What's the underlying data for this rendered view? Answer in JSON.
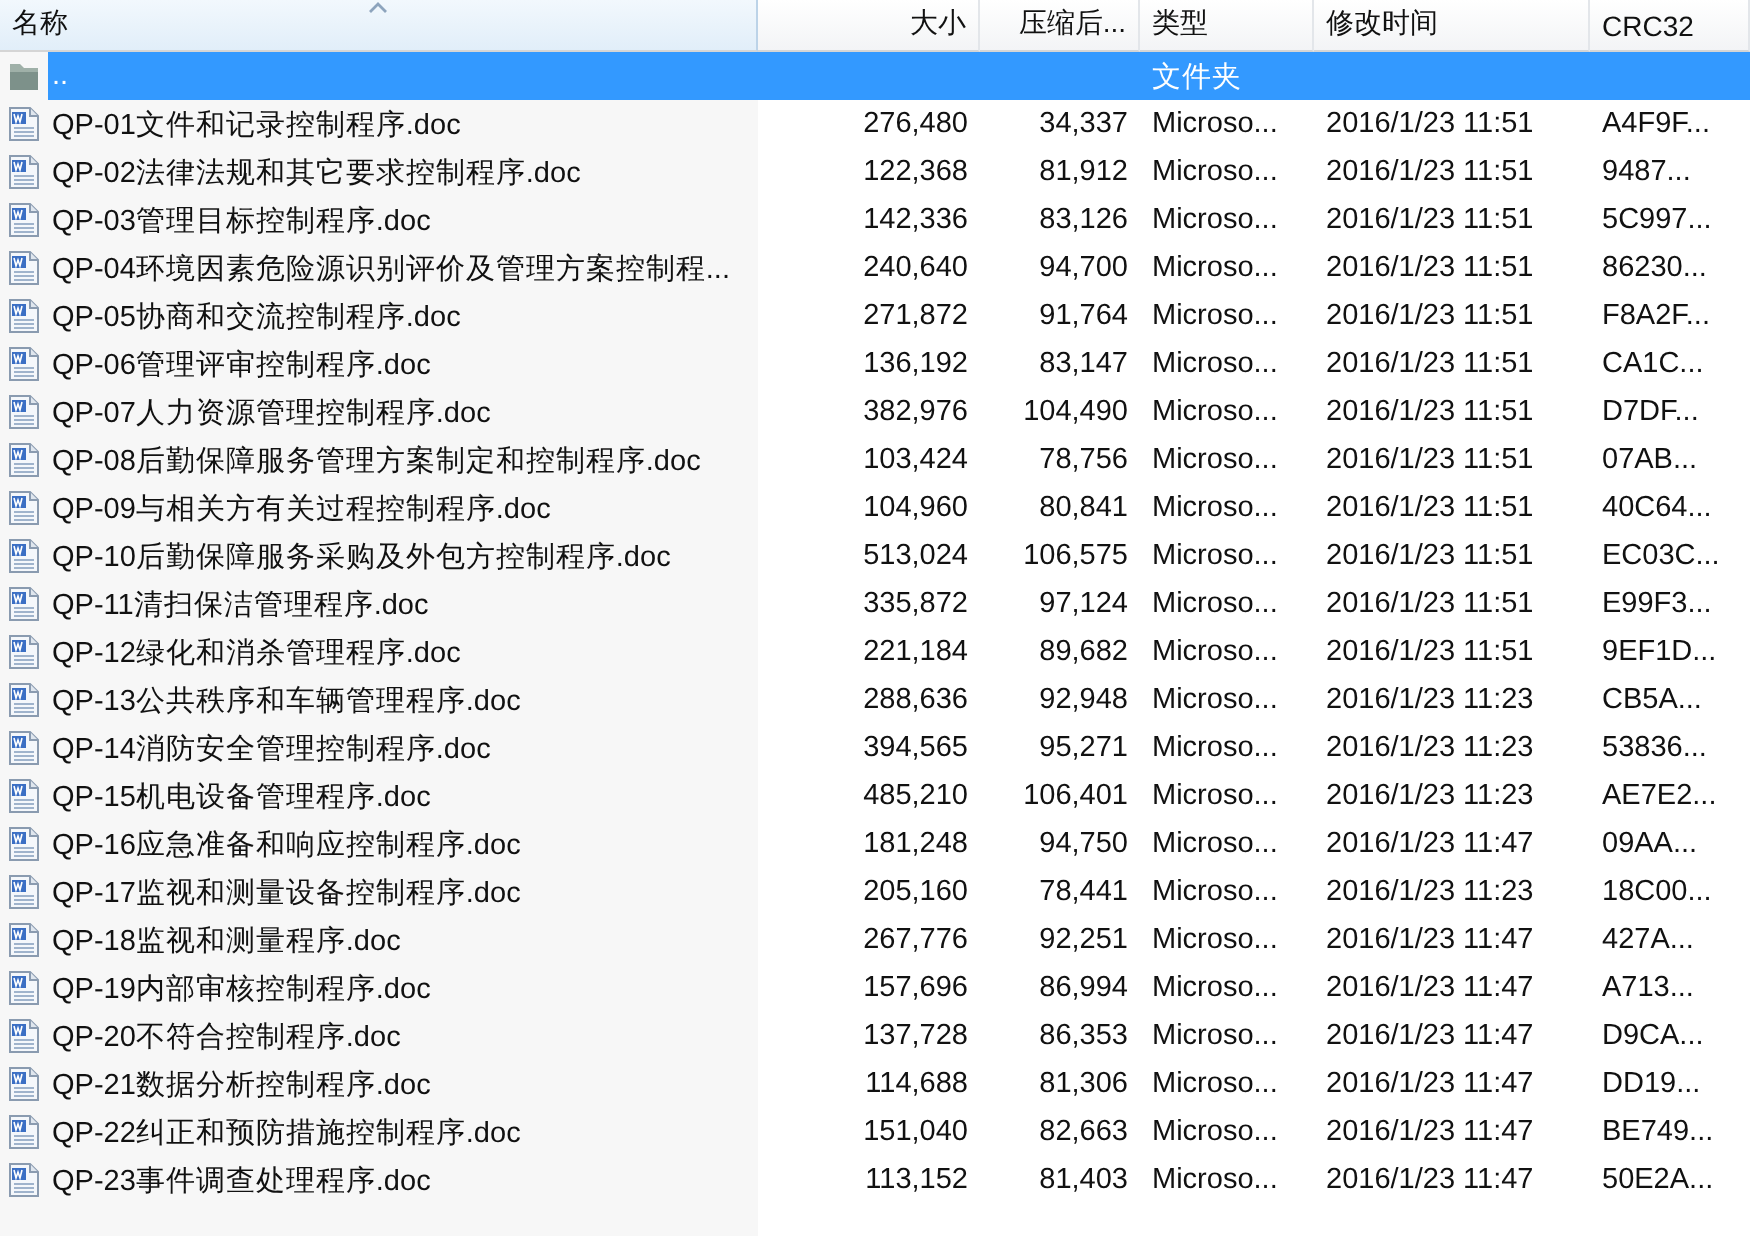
{
  "columns": [
    {
      "label": "名称",
      "sorted": true
    },
    {
      "label": "大小",
      "sorted": false
    },
    {
      "label": "压缩后...",
      "sorted": false
    },
    {
      "label": "类型",
      "sorted": false
    },
    {
      "label": "修改时间",
      "sorted": false
    },
    {
      "label": "CRC32",
      "sorted": false
    }
  ],
  "rows": [
    {
      "kind": "folder",
      "selected": true,
      "name": "..",
      "type": "文件夹"
    },
    {
      "kind": "doc",
      "selected": false,
      "name": "QP-01文件和记录控制程序.doc",
      "size": "276,480",
      "packed": "34,337",
      "type": "Microso...",
      "modified": "2016/1/23 11:51",
      "crc": "A4F9F..."
    },
    {
      "kind": "doc",
      "selected": false,
      "name": "QP-02法律法规和其它要求控制程序.doc",
      "size": "122,368",
      "packed": "81,912",
      "type": "Microso...",
      "modified": "2016/1/23 11:51",
      "crc": "9487..."
    },
    {
      "kind": "doc",
      "selected": false,
      "name": "QP-03管理目标控制程序.doc",
      "size": "142,336",
      "packed": "83,126",
      "type": "Microso...",
      "modified": "2016/1/23 11:51",
      "crc": "5C997..."
    },
    {
      "kind": "doc",
      "selected": false,
      "name": "QP-04环境因素危险源识别评价及管理方案控制程...",
      "size": "240,640",
      "packed": "94,700",
      "type": "Microso...",
      "modified": "2016/1/23 11:51",
      "crc": "86230..."
    },
    {
      "kind": "doc",
      "selected": false,
      "name": "QP-05协商和交流控制程序.doc",
      "size": "271,872",
      "packed": "91,764",
      "type": "Microso...",
      "modified": "2016/1/23 11:51",
      "crc": "F8A2F..."
    },
    {
      "kind": "doc",
      "selected": false,
      "name": "QP-06管理评审控制程序.doc",
      "size": "136,192",
      "packed": "83,147",
      "type": "Microso...",
      "modified": "2016/1/23 11:51",
      "crc": "CA1C..."
    },
    {
      "kind": "doc",
      "selected": false,
      "name": "QP-07人力资源管理控制程序.doc",
      "size": "382,976",
      "packed": "104,490",
      "type": "Microso...",
      "modified": "2016/1/23 11:51",
      "crc": "D7DF..."
    },
    {
      "kind": "doc",
      "selected": false,
      "name": "QP-08后勤保障服务管理方案制定和控制程序.doc",
      "size": "103,424",
      "packed": "78,756",
      "type": "Microso...",
      "modified": "2016/1/23 11:51",
      "crc": "07AB..."
    },
    {
      "kind": "doc",
      "selected": false,
      "name": "QP-09与相关方有关过程控制程序.doc",
      "size": "104,960",
      "packed": "80,841",
      "type": "Microso...",
      "modified": "2016/1/23 11:51",
      "crc": "40C64..."
    },
    {
      "kind": "doc",
      "selected": false,
      "name": "QP-10后勤保障服务采购及外包方控制程序.doc",
      "size": "513,024",
      "packed": "106,575",
      "type": "Microso...",
      "modified": "2016/1/23 11:51",
      "crc": "EC03C..."
    },
    {
      "kind": "doc",
      "selected": false,
      "name": "QP-11清扫保洁管理程序.doc",
      "size": "335,872",
      "packed": "97,124",
      "type": "Microso...",
      "modified": "2016/1/23 11:51",
      "crc": "E99F3..."
    },
    {
      "kind": "doc",
      "selected": false,
      "name": "QP-12绿化和消杀管理程序.doc",
      "size": "221,184",
      "packed": "89,682",
      "type": "Microso...",
      "modified": "2016/1/23 11:51",
      "crc": "9EF1D..."
    },
    {
      "kind": "doc",
      "selected": false,
      "name": "QP-13公共秩序和车辆管理程序.doc",
      "size": "288,636",
      "packed": "92,948",
      "type": "Microso...",
      "modified": "2016/1/23 11:23",
      "crc": "CB5A..."
    },
    {
      "kind": "doc",
      "selected": false,
      "name": "QP-14消防安全管理控制程序.doc",
      "size": "394,565",
      "packed": "95,271",
      "type": "Microso...",
      "modified": "2016/1/23 11:23",
      "crc": "53836..."
    },
    {
      "kind": "doc",
      "selected": false,
      "name": "QP-15机电设备管理程序.doc",
      "size": "485,210",
      "packed": "106,401",
      "type": "Microso...",
      "modified": "2016/1/23 11:23",
      "crc": "AE7E2..."
    },
    {
      "kind": "doc",
      "selected": false,
      "name": "QP-16应急准备和响应控制程序.doc",
      "size": "181,248",
      "packed": "94,750",
      "type": "Microso...",
      "modified": "2016/1/23 11:47",
      "crc": "09AA..."
    },
    {
      "kind": "doc",
      "selected": false,
      "name": "QP-17监视和测量设备控制程序.doc",
      "size": "205,160",
      "packed": "78,441",
      "type": "Microso...",
      "modified": "2016/1/23 11:23",
      "crc": "18C00..."
    },
    {
      "kind": "doc",
      "selected": false,
      "name": "QP-18监视和测量程序.doc",
      "size": "267,776",
      "packed": "92,251",
      "type": "Microso...",
      "modified": "2016/1/23 11:47",
      "crc": "427A..."
    },
    {
      "kind": "doc",
      "selected": false,
      "name": "QP-19内部审核控制程序.doc",
      "size": "157,696",
      "packed": "86,994",
      "type": "Microso...",
      "modified": "2016/1/23 11:47",
      "crc": "A713..."
    },
    {
      "kind": "doc",
      "selected": false,
      "name": "QP-20不符合控制程序.doc",
      "size": "137,728",
      "packed": "86,353",
      "type": "Microso...",
      "modified": "2016/1/23 11:47",
      "crc": "D9CA..."
    },
    {
      "kind": "doc",
      "selected": false,
      "name": "QP-21数据分析控制程序.doc",
      "size": "114,688",
      "packed": "81,306",
      "type": "Microso...",
      "modified": "2016/1/23 11:47",
      "crc": "DD19..."
    },
    {
      "kind": "doc",
      "selected": false,
      "name": "QP-22纠正和预防措施控制程序.doc",
      "size": "151,040",
      "packed": "82,663",
      "type": "Microso...",
      "modified": "2016/1/23 11:47",
      "crc": "BE749..."
    },
    {
      "kind": "doc",
      "selected": false,
      "name": "QP-23事件调查处理程序.doc",
      "size": "113,152",
      "packed": "81,403",
      "type": "Microso...",
      "modified": "2016/1/23 11:47",
      "crc": "50E2A..."
    }
  ]
}
